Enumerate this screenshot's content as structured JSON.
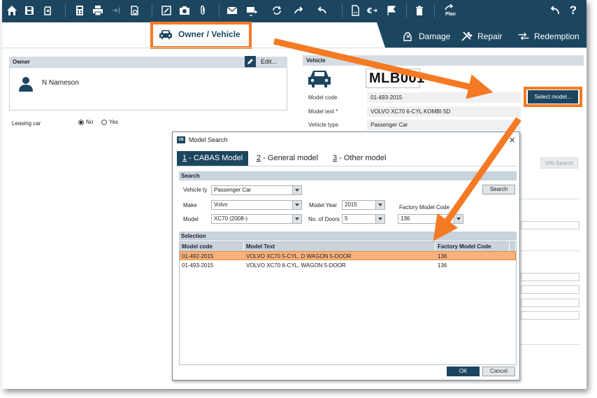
{
  "toolbar": {
    "plan_label": "Plan"
  },
  "tabs": {
    "owner_vehicle": "Owner / Vehicle",
    "damage": "Damage",
    "repair": "Repair",
    "redemption": "Redemption"
  },
  "owner": {
    "header": "Owner",
    "edit_label": "Edit...",
    "name": "N Nameson",
    "leasing_label": "Leasing car",
    "leasing_options": [
      "No",
      "Yes"
    ],
    "leasing_selected": "No"
  },
  "vehicle": {
    "header": "Vehicle",
    "plate": "MLB001",
    "fields": [
      {
        "label": "Model code",
        "value": "01-493-2015"
      },
      {
        "label": "Model text *",
        "value": "VOLVO XC70 6-CYL KOMBI 5D"
      },
      {
        "label": "Vehicle type",
        "value": "Passenger Car"
      }
    ],
    "select_model_label": "Select model...",
    "vin_search_label": "VIN Search"
  },
  "dialog": {
    "title": "Model Search",
    "icon_text": "CB",
    "tabs": [
      {
        "num": "1",
        "label": " - CABAS Model"
      },
      {
        "num": "2",
        "label": " - General model"
      },
      {
        "num": "3",
        "label": " - Other model"
      }
    ],
    "search_header": "Search",
    "search_button": "Search",
    "fields": {
      "vehicle_type_label": "Vehicle ty",
      "vehicle_type_value": "Passenger Car",
      "make_label": "Make",
      "make_value": "Volvo",
      "model_label": "Model",
      "model_value": "XC70 (2008-)",
      "model_year_label": "Model Year",
      "model_year_value": "2015",
      "doors_label": "No. of Doors",
      "doors_value": "5",
      "factory_label": "Factory Model Code",
      "factory_value": "136"
    },
    "selection_header": "Selection",
    "columns": [
      "Model code",
      "Model Text",
      "Factory Model Code"
    ],
    "rows": [
      {
        "code": "01-492-2015",
        "text": "VOLVO XC70 5-CYL. D WAGON 5-DOOR",
        "factory": "136",
        "selected": true
      },
      {
        "code": "01-493-2015",
        "text": "VOLVO XC70 6-CYL. WAGON 5-DOOR",
        "factory": "136",
        "selected": false
      }
    ],
    "ok_label": "OK",
    "cancel_label": "Cancel"
  },
  "colors": {
    "primary": "#1c4660",
    "highlight": "#f47a23",
    "row_selected": "#f9b27c"
  }
}
